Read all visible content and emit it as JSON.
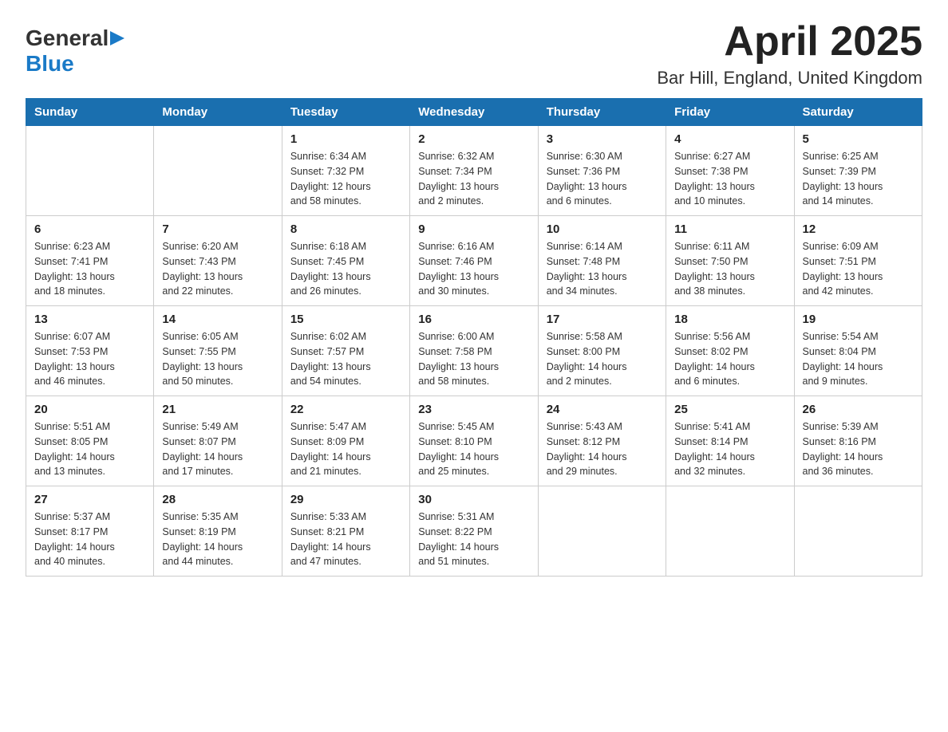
{
  "header": {
    "logo_general": "General",
    "logo_blue": "Blue",
    "month_title": "April 2025",
    "location": "Bar Hill, England, United Kingdom"
  },
  "days_of_week": [
    "Sunday",
    "Monday",
    "Tuesday",
    "Wednesday",
    "Thursday",
    "Friday",
    "Saturday"
  ],
  "weeks": [
    [
      {
        "day": "",
        "info": ""
      },
      {
        "day": "",
        "info": ""
      },
      {
        "day": "1",
        "info": "Sunrise: 6:34 AM\nSunset: 7:32 PM\nDaylight: 12 hours\nand 58 minutes."
      },
      {
        "day": "2",
        "info": "Sunrise: 6:32 AM\nSunset: 7:34 PM\nDaylight: 13 hours\nand 2 minutes."
      },
      {
        "day": "3",
        "info": "Sunrise: 6:30 AM\nSunset: 7:36 PM\nDaylight: 13 hours\nand 6 minutes."
      },
      {
        "day": "4",
        "info": "Sunrise: 6:27 AM\nSunset: 7:38 PM\nDaylight: 13 hours\nand 10 minutes."
      },
      {
        "day": "5",
        "info": "Sunrise: 6:25 AM\nSunset: 7:39 PM\nDaylight: 13 hours\nand 14 minutes."
      }
    ],
    [
      {
        "day": "6",
        "info": "Sunrise: 6:23 AM\nSunset: 7:41 PM\nDaylight: 13 hours\nand 18 minutes."
      },
      {
        "day": "7",
        "info": "Sunrise: 6:20 AM\nSunset: 7:43 PM\nDaylight: 13 hours\nand 22 minutes."
      },
      {
        "day": "8",
        "info": "Sunrise: 6:18 AM\nSunset: 7:45 PM\nDaylight: 13 hours\nand 26 minutes."
      },
      {
        "day": "9",
        "info": "Sunrise: 6:16 AM\nSunset: 7:46 PM\nDaylight: 13 hours\nand 30 minutes."
      },
      {
        "day": "10",
        "info": "Sunrise: 6:14 AM\nSunset: 7:48 PM\nDaylight: 13 hours\nand 34 minutes."
      },
      {
        "day": "11",
        "info": "Sunrise: 6:11 AM\nSunset: 7:50 PM\nDaylight: 13 hours\nand 38 minutes."
      },
      {
        "day": "12",
        "info": "Sunrise: 6:09 AM\nSunset: 7:51 PM\nDaylight: 13 hours\nand 42 minutes."
      }
    ],
    [
      {
        "day": "13",
        "info": "Sunrise: 6:07 AM\nSunset: 7:53 PM\nDaylight: 13 hours\nand 46 minutes."
      },
      {
        "day": "14",
        "info": "Sunrise: 6:05 AM\nSunset: 7:55 PM\nDaylight: 13 hours\nand 50 minutes."
      },
      {
        "day": "15",
        "info": "Sunrise: 6:02 AM\nSunset: 7:57 PM\nDaylight: 13 hours\nand 54 minutes."
      },
      {
        "day": "16",
        "info": "Sunrise: 6:00 AM\nSunset: 7:58 PM\nDaylight: 13 hours\nand 58 minutes."
      },
      {
        "day": "17",
        "info": "Sunrise: 5:58 AM\nSunset: 8:00 PM\nDaylight: 14 hours\nand 2 minutes."
      },
      {
        "day": "18",
        "info": "Sunrise: 5:56 AM\nSunset: 8:02 PM\nDaylight: 14 hours\nand 6 minutes."
      },
      {
        "day": "19",
        "info": "Sunrise: 5:54 AM\nSunset: 8:04 PM\nDaylight: 14 hours\nand 9 minutes."
      }
    ],
    [
      {
        "day": "20",
        "info": "Sunrise: 5:51 AM\nSunset: 8:05 PM\nDaylight: 14 hours\nand 13 minutes."
      },
      {
        "day": "21",
        "info": "Sunrise: 5:49 AM\nSunset: 8:07 PM\nDaylight: 14 hours\nand 17 minutes."
      },
      {
        "day": "22",
        "info": "Sunrise: 5:47 AM\nSunset: 8:09 PM\nDaylight: 14 hours\nand 21 minutes."
      },
      {
        "day": "23",
        "info": "Sunrise: 5:45 AM\nSunset: 8:10 PM\nDaylight: 14 hours\nand 25 minutes."
      },
      {
        "day": "24",
        "info": "Sunrise: 5:43 AM\nSunset: 8:12 PM\nDaylight: 14 hours\nand 29 minutes."
      },
      {
        "day": "25",
        "info": "Sunrise: 5:41 AM\nSunset: 8:14 PM\nDaylight: 14 hours\nand 32 minutes."
      },
      {
        "day": "26",
        "info": "Sunrise: 5:39 AM\nSunset: 8:16 PM\nDaylight: 14 hours\nand 36 minutes."
      }
    ],
    [
      {
        "day": "27",
        "info": "Sunrise: 5:37 AM\nSunset: 8:17 PM\nDaylight: 14 hours\nand 40 minutes."
      },
      {
        "day": "28",
        "info": "Sunrise: 5:35 AM\nSunset: 8:19 PM\nDaylight: 14 hours\nand 44 minutes."
      },
      {
        "day": "29",
        "info": "Sunrise: 5:33 AM\nSunset: 8:21 PM\nDaylight: 14 hours\nand 47 minutes."
      },
      {
        "day": "30",
        "info": "Sunrise: 5:31 AM\nSunset: 8:22 PM\nDaylight: 14 hours\nand 51 minutes."
      },
      {
        "day": "",
        "info": ""
      },
      {
        "day": "",
        "info": ""
      },
      {
        "day": "",
        "info": ""
      }
    ]
  ]
}
